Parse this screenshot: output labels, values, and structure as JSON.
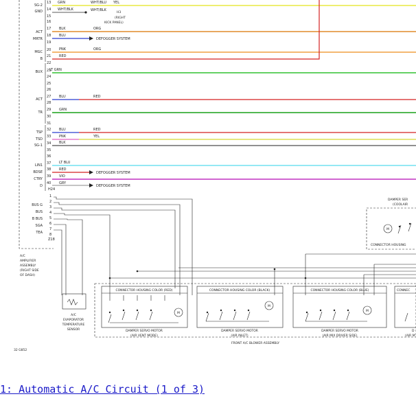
{
  "caption": "1: Automatic A/C Circuit (1 of 3)",
  "figure_id": "32 G852",
  "left_signals": [
    "SG-2",
    "GND",
    "ACT",
    "MRTR",
    "MGC",
    "B",
    "BUX",
    "ACT",
    "TR",
    "TSP",
    "TSD",
    "SG-1",
    "LIN1",
    "BDSE",
    "CTRY",
    "D"
  ],
  "bus_signals": [
    "BUS G",
    "BUS",
    "B BUS",
    "SGA",
    "TEA"
  ],
  "connector_id": "H24",
  "connector_id_2": "Z18",
  "wires": {
    "grn": "GRN",
    "wht_blk": "WHT/BLK",
    "blk": "BLK",
    "blu": "BLU",
    "pnk": "PNK",
    "red": "RED",
    "lt_grn": "LT GRN",
    "yel": "YEL",
    "org": "ORG",
    "lt_blu": "LT BLU",
    "vio": "VIO",
    "gry": "GRY",
    "wht_blu": "WHT/BLU"
  },
  "notes": {
    "h3": "H3",
    "right_kick_1": "(RIGHT",
    "right_kick_2": "KICK PANEL)",
    "defogger": "DEFOGGER SYSTEM"
  },
  "amplifier": [
    "A/C",
    "AMPLIFIER",
    "ASSEMBLY",
    "(RIGHT SIDE",
    "OF DASH)"
  ],
  "evap_sensor": [
    "A/C",
    "EVAPORATOR",
    "TEMPERATURE",
    "SENSOR"
  ],
  "connectors": {
    "red": "CONNECTOR HOUSING COLOR (RED)",
    "black": "CONNECTOR HOUSING COLOR (BLACK)",
    "blue": "CONNECTOR HOUSING COLOR (BLUE)",
    "partial_right": "CONNEC",
    "upper_right": "CONNECTOR HOUSING"
  },
  "motors": {
    "vent_1": "DAMPER SERVO MOTOR",
    "vent_2": "(AIR VENT MODE)",
    "inlet_1": "DAMPER SERVO MOTOR",
    "inlet_2": "(AIR INLET)",
    "mix_1": "DAMPER SERVO MOTOR",
    "mix_2": "(AIR MIX DRIVER SIDE)",
    "upper_1": "DAMPER SER",
    "upper_2": "(COOLAIR",
    "partial_1": "D",
    "partial_2": "(AIR M"
  },
  "blower_assembly": "FRONT A/C BLOWER ASSEMBLY",
  "colors": {
    "caption": "#1a1ac8",
    "ink": "#222222"
  }
}
